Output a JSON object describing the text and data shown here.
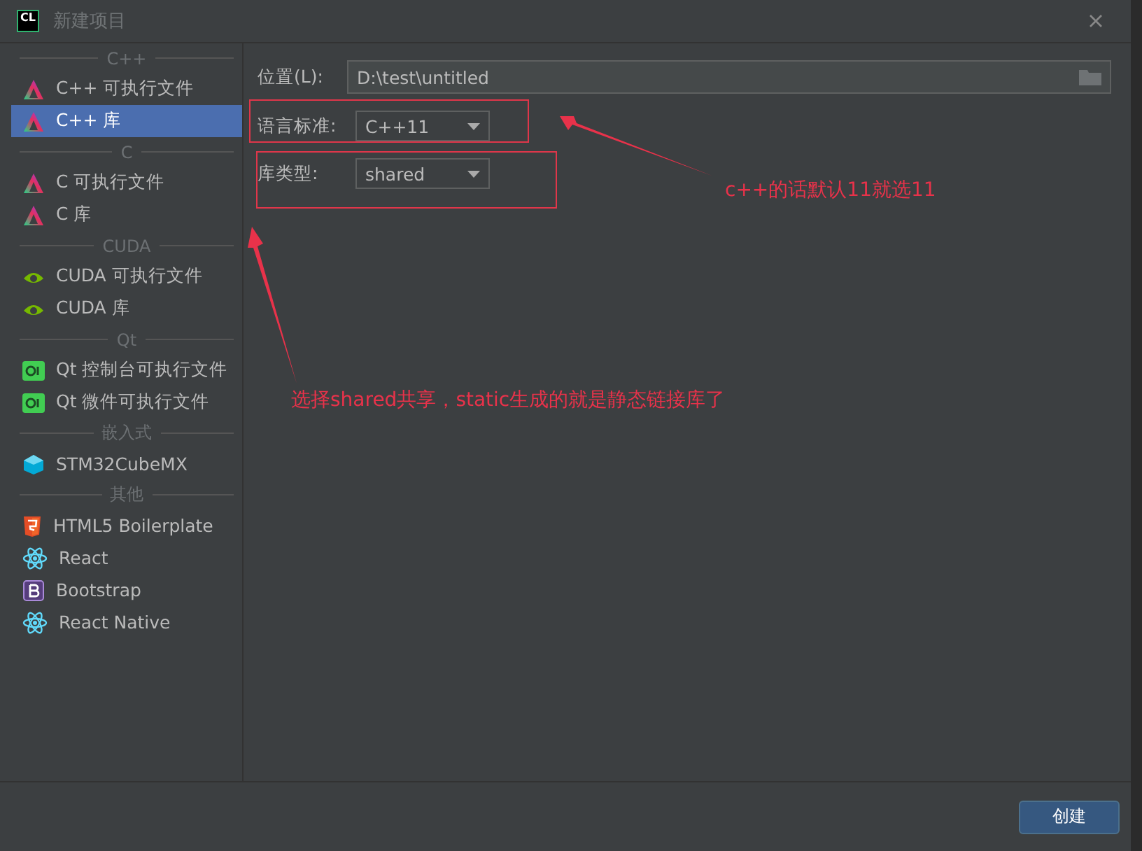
{
  "window": {
    "title": "新建项目",
    "app_icon": "CL"
  },
  "sidebar": {
    "groups": [
      {
        "label": "C++",
        "items": [
          {
            "label": "C++ 可执行文件",
            "kind": "clion",
            "selected": false
          },
          {
            "label": "C++ 库",
            "kind": "clion",
            "selected": true
          }
        ]
      },
      {
        "label": "C",
        "items": [
          {
            "label": "C 可执行文件",
            "kind": "clion",
            "selected": false
          },
          {
            "label": "C 库",
            "kind": "clion",
            "selected": false
          }
        ]
      },
      {
        "label": "CUDA",
        "items": [
          {
            "label": "CUDA 可执行文件",
            "kind": "cuda",
            "selected": false
          },
          {
            "label": "CUDA 库",
            "kind": "cuda",
            "selected": false
          }
        ]
      },
      {
        "label": "Qt",
        "items": [
          {
            "label": "Qt 控制台可执行文件",
            "kind": "qt",
            "selected": false
          },
          {
            "label": "Qt 微件可执行文件",
            "kind": "qt",
            "selected": false
          }
        ]
      },
      {
        "label": "嵌入式",
        "items": [
          {
            "label": "STM32CubeMX",
            "kind": "cube",
            "selected": false
          }
        ]
      },
      {
        "label": "其他",
        "items": [
          {
            "label": "HTML5 Boilerplate",
            "kind": "html5",
            "selected": false
          },
          {
            "label": "React",
            "kind": "react",
            "selected": false
          },
          {
            "label": "Bootstrap",
            "kind": "bootstrap",
            "selected": false
          },
          {
            "label": "React Native",
            "kind": "react",
            "selected": false
          }
        ]
      }
    ]
  },
  "form": {
    "location": {
      "label": "位置(L):",
      "value": "D:\\test\\untitled"
    },
    "fields": [
      {
        "label": "语言标准:",
        "value": "C++11"
      },
      {
        "label": "库类型:",
        "value": "shared"
      }
    ]
  },
  "annotations": [
    {
      "text": "c++的话默认11就选11"
    },
    {
      "text": "选择shared共享，static生成的就是静态链接库了"
    }
  ],
  "buttons": [
    {
      "label": "创建"
    }
  ]
}
